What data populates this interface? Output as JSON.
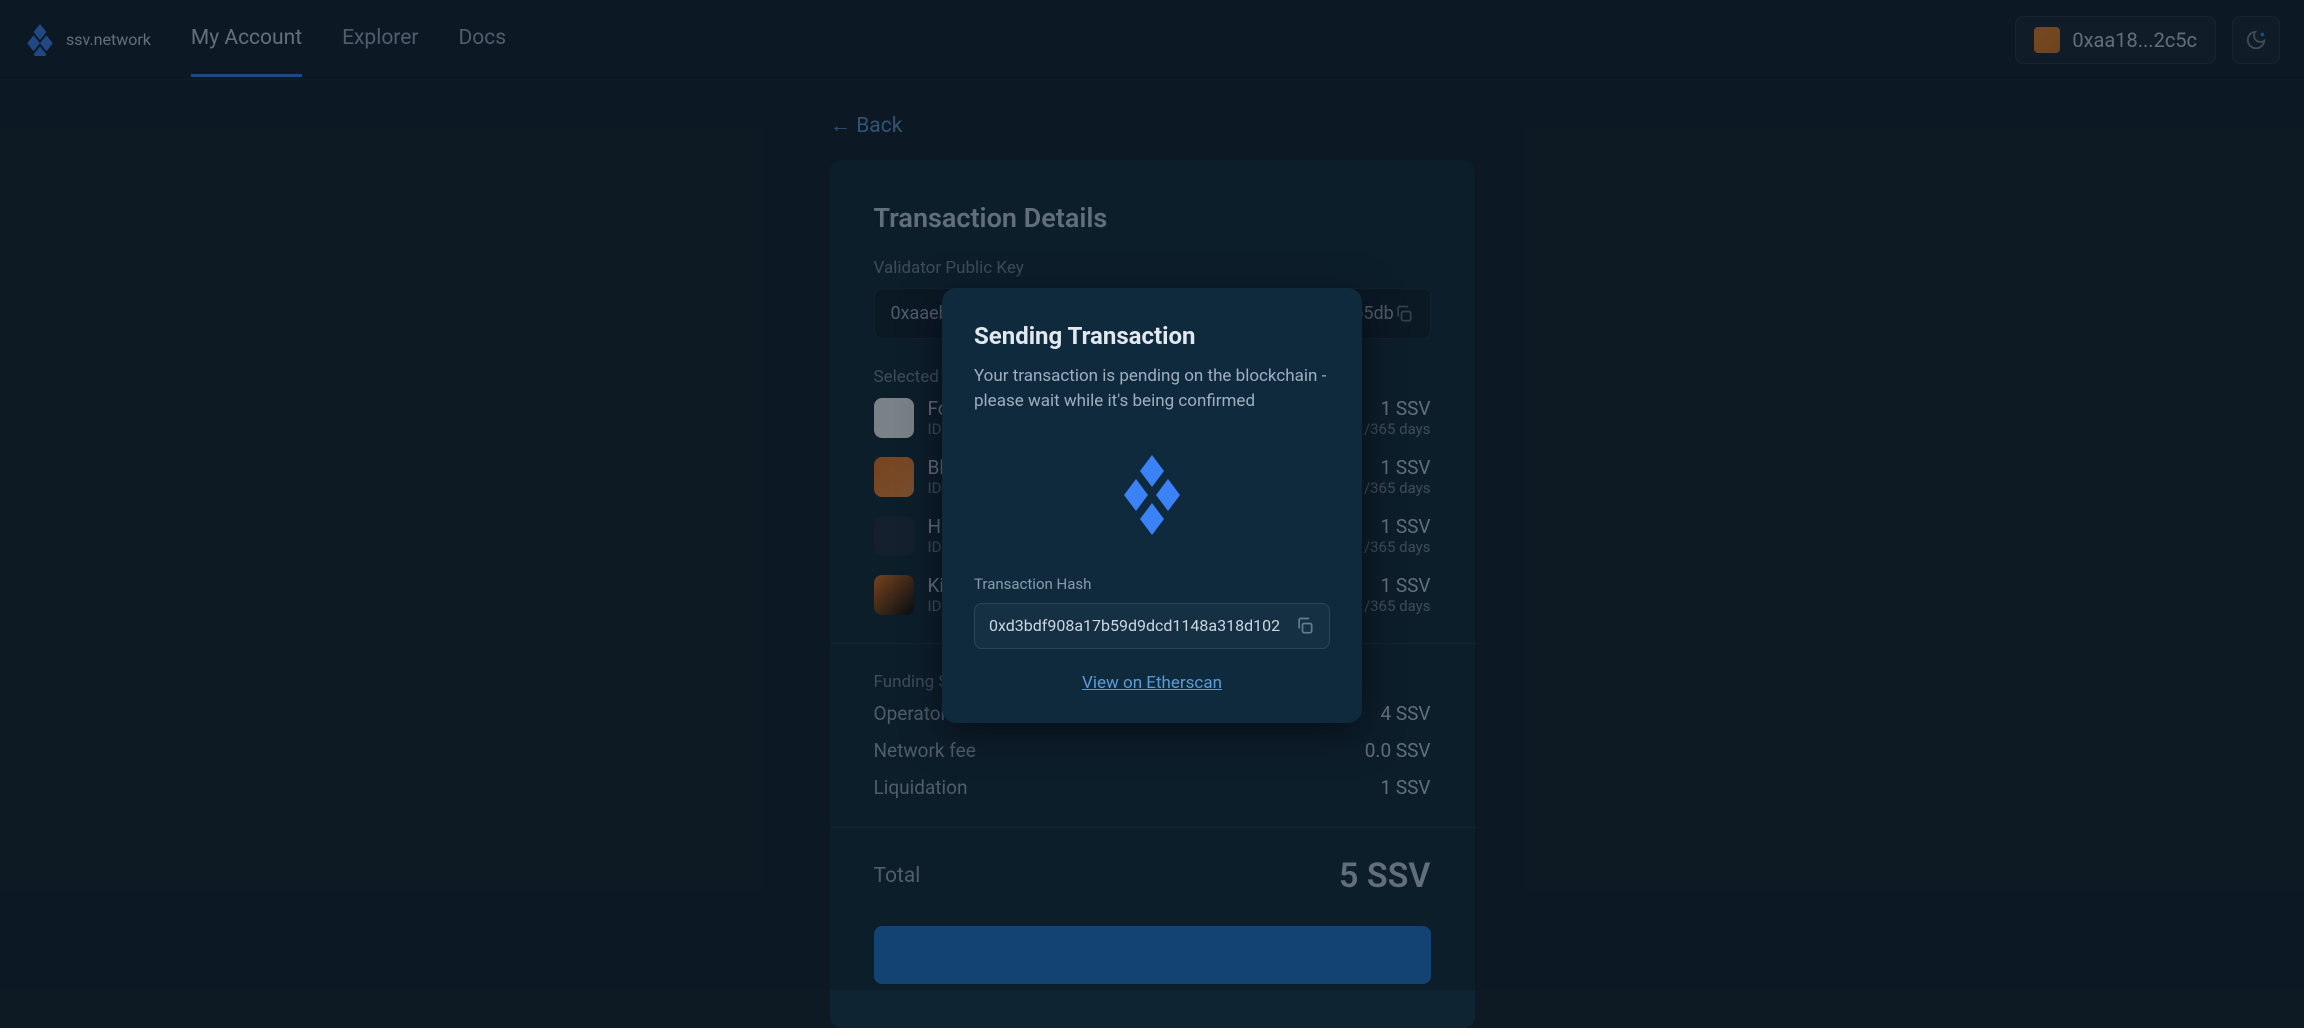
{
  "header": {
    "logo_text": "ssv.network",
    "nav": {
      "my_account": "My Account",
      "explorer": "Explorer",
      "docs": "Docs"
    },
    "wallet_address": "0xaa18...2c5c"
  },
  "back_link": "← Back",
  "card": {
    "title": "Transaction Details",
    "pubkey_label": "Validator Public Key",
    "pubkey_value": "0xaaebab76f205c191080ad7642916c5e1b063d761346f0b5db35cet",
    "operators_label": "Selected Operators",
    "operators": [
      {
        "name": "Foundry",
        "id": "ID: 13",
        "fee": "1 SSV",
        "period": "/365 days"
      },
      {
        "name": "Blockscape",
        "id": "ID: 7",
        "fee": "1 SSV",
        "period": "/365 days"
      },
      {
        "name": "Hash",
        "id": "ID: 8",
        "fee": "1 SSV",
        "period": "/365 days"
      },
      {
        "name": "Kiln",
        "id": "ID: 9",
        "fee": "1 SSV",
        "period": "/365 days"
      }
    ],
    "summary_label": "Funding Sum",
    "summary": [
      {
        "label": "Operator fee",
        "value": "4 SSV"
      },
      {
        "label": "Network fee",
        "value": "0.0 SSV"
      },
      {
        "label": "Liquidation",
        "value": "1 SSV"
      }
    ],
    "total_label": "Total",
    "total_value": "5 SSV"
  },
  "modal": {
    "title": "Sending Transaction",
    "description": "Your transaction is pending on the blockchain - please wait while it's being confirmed",
    "hash_label": "Transaction Hash",
    "hash_value": "0xd3bdf908a17b59d9dcd1148a318d102",
    "view_link": "View on Etherscan"
  }
}
